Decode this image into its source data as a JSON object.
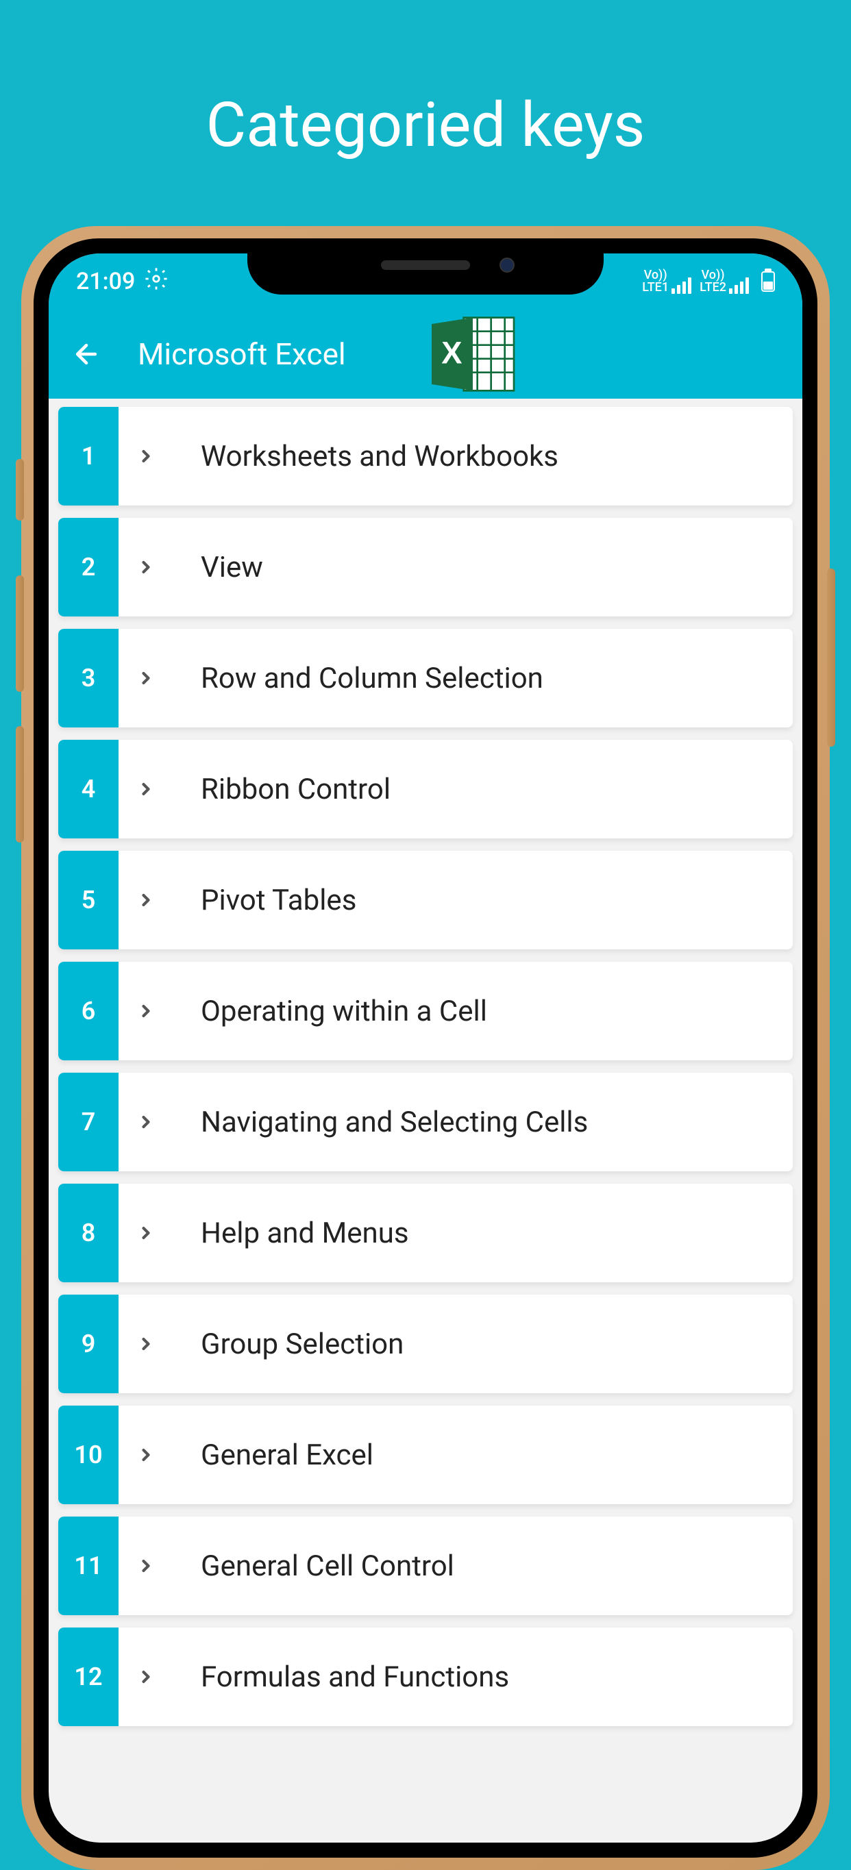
{
  "page": {
    "title": "Categoried keys"
  },
  "status": {
    "time": "21:09",
    "lte1": "LTE1",
    "lte2": "LTE2",
    "vo1": "Vo))",
    "vo2": "Vo))"
  },
  "header": {
    "title": "Microsoft Excel"
  },
  "items": [
    {
      "number": "1",
      "label": "Worksheets and Workbooks"
    },
    {
      "number": "2",
      "label": "View"
    },
    {
      "number": "3",
      "label": "Row and Column Selection"
    },
    {
      "number": "4",
      "label": "Ribbon Control"
    },
    {
      "number": "5",
      "label": "Pivot Tables"
    },
    {
      "number": "6",
      "label": "Operating within a Cell"
    },
    {
      "number": "7",
      "label": "Navigating and Selecting Cells"
    },
    {
      "number": "8",
      "label": "Help and Menus"
    },
    {
      "number": "9",
      "label": "Group Selection"
    },
    {
      "number": "10",
      "label": "General Excel"
    },
    {
      "number": "11",
      "label": "General Cell Control"
    },
    {
      "number": "12",
      "label": "Formulas and Functions"
    }
  ]
}
